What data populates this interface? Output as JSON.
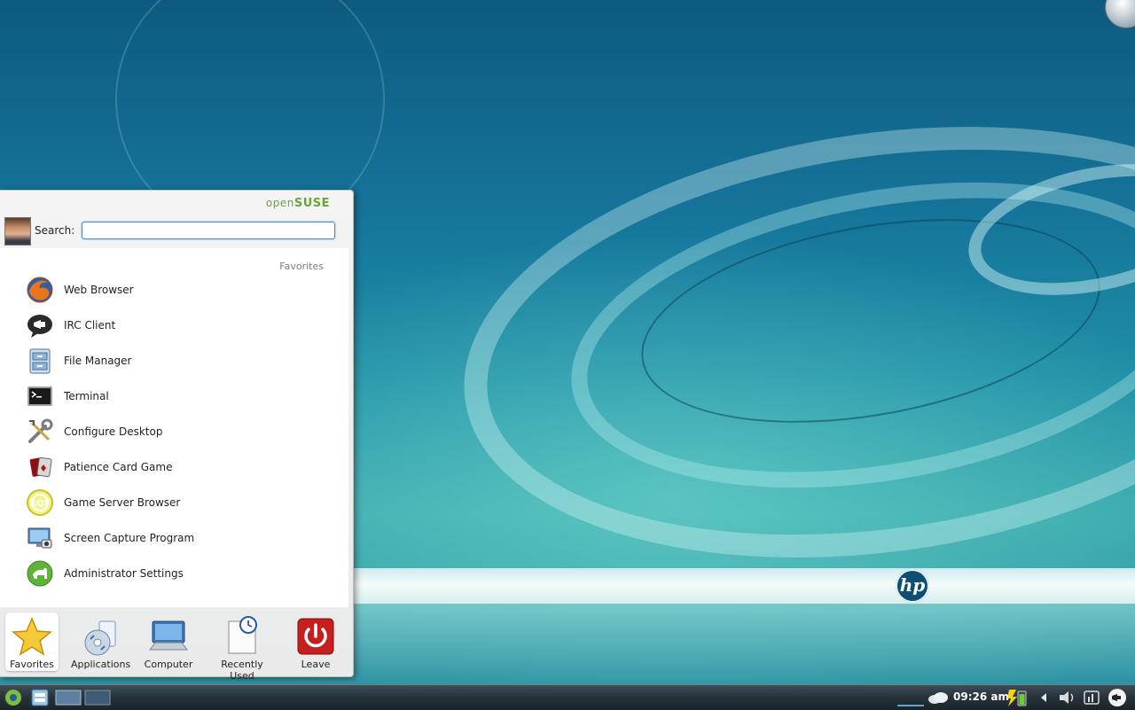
{
  "menu": {
    "brand_prefix": "open",
    "brand_suffix": "SUSE",
    "search_label": "Search:",
    "search_value": "",
    "section_header": "Favorites",
    "favorites": [
      {
        "label": "Web Browser",
        "icon": "firefox-icon"
      },
      {
        "label": "IRC Client",
        "icon": "irc-icon"
      },
      {
        "label": "File Manager",
        "icon": "file-manager-icon"
      },
      {
        "label": "Terminal",
        "icon": "terminal-icon"
      },
      {
        "label": "Configure Desktop",
        "icon": "tools-icon"
      },
      {
        "label": "Patience Card Game",
        "icon": "cards-icon"
      },
      {
        "label": "Game Server Browser",
        "icon": "game-server-icon"
      },
      {
        "label": "Screen Capture Program",
        "icon": "screen-capture-icon"
      },
      {
        "label": "Administrator Settings",
        "icon": "admin-icon"
      }
    ],
    "tabs": [
      {
        "label": "Favorites",
        "icon": "star-icon"
      },
      {
        "label": "Applications",
        "icon": "applications-icon"
      },
      {
        "label": "Computer",
        "icon": "computer-icon"
      },
      {
        "label": "Recently Used",
        "icon": "clock-document-icon"
      },
      {
        "label": "Leave",
        "icon": "power-icon"
      }
    ]
  },
  "desktop": {
    "logo_text": "hp"
  },
  "taskbar": {
    "clock": "09:26 am"
  },
  "colors": {
    "brand_green": "#6aa43a",
    "search_border": "#4e86c9",
    "leave_red": "#c61f1f"
  }
}
